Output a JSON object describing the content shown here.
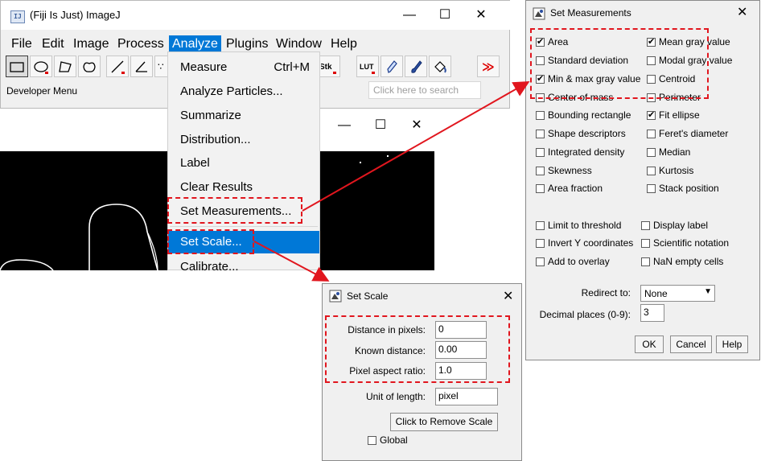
{
  "main_window": {
    "title": "(Fiji Is Just) ImageJ",
    "app_icon_text": "IJ",
    "controls": {
      "minimize": "—",
      "maximize": "☐",
      "close": "✕"
    },
    "menus": [
      "File",
      "Edit",
      "Image",
      "Process",
      "Analyze",
      "Plugins",
      "Window",
      "Help"
    ],
    "toolbar": {
      "text_tools": {
        "stk": "Stk",
        "lut": "LUT"
      },
      "more_tools": "≫",
      "tools": [
        "rectangle-tool",
        "oval-tool",
        "polygon-tool",
        "freehand-tool",
        "line-tool",
        "angle-tool",
        "point-tool",
        "stack-tool",
        "lut-tool",
        "pencil-tool",
        "brush-tool",
        "flood-fill-tool",
        "more-tools"
      ]
    },
    "developer_menu": "Developer Menu",
    "search": {
      "placeholder": "Click here to search"
    }
  },
  "image_window": {
    "controls": {
      "minimize": "—",
      "maximize": "☐",
      "close": "✕"
    }
  },
  "analyze_menu": {
    "items": [
      {
        "label": "Measure",
        "shortcut": "Ctrl+M"
      },
      {
        "label": "Analyze Particles..."
      },
      {
        "label": "Summarize"
      },
      {
        "label": "Distribution..."
      },
      {
        "label": "Label"
      },
      {
        "label": "Clear Results"
      },
      {
        "label": "Set Measurements..."
      },
      {
        "label": "Set Scale..."
      },
      {
        "label": "Calibrate..."
      }
    ]
  },
  "set_measurements": {
    "title": "Set Measurements",
    "left_column": [
      {
        "label": "Area",
        "checked": true
      },
      {
        "label": "Standard deviation",
        "checked": false
      },
      {
        "label": "Min & max gray value",
        "checked": true
      },
      {
        "label": "Center of mass",
        "checked": false
      },
      {
        "label": "Bounding rectangle",
        "checked": false
      },
      {
        "label": "Shape descriptors",
        "checked": false
      },
      {
        "label": "Integrated density",
        "checked": false
      },
      {
        "label": "Skewness",
        "checked": false
      },
      {
        "label": "Area fraction",
        "checked": false
      }
    ],
    "right_column": [
      {
        "label": "Mean gray value",
        "checked": true
      },
      {
        "label": "Modal gray value",
        "checked": false
      },
      {
        "label": "Centroid",
        "checked": false
      },
      {
        "label": "Perimeter",
        "checked": false
      },
      {
        "label": "Fit ellipse",
        "checked": true
      },
      {
        "label": "Feret's diameter",
        "checked": false
      },
      {
        "label": "Median",
        "checked": false
      },
      {
        "label": "Kurtosis",
        "checked": false
      },
      {
        "label": "Stack position",
        "checked": false
      }
    ],
    "options_left": [
      {
        "label": "Limit to threshold",
        "checked": false
      },
      {
        "label": "Invert Y coordinates",
        "checked": false
      },
      {
        "label": "Add to overlay",
        "checked": false
      }
    ],
    "options_right": [
      {
        "label": "Display label",
        "checked": false
      },
      {
        "label": "Scientific notation",
        "checked": false
      },
      {
        "label": "NaN empty cells",
        "checked": false
      }
    ],
    "redirect_label": "Redirect to:",
    "redirect_value": "None",
    "decimal_label": "Decimal places (0-9):",
    "decimal_value": "3",
    "ok": "OK",
    "cancel": "Cancel",
    "help": "Help"
  },
  "set_scale": {
    "title": "Set Scale",
    "distance_label": "Distance in pixels:",
    "distance_value": "0",
    "known_label": "Known distance:",
    "known_value": "0.00",
    "aspect_label": "Pixel aspect ratio:",
    "aspect_value": "1.0",
    "unit_label": "Unit of length:",
    "unit_value": "pixel",
    "remove_button": "Click to Remove Scale",
    "global_label": "Global",
    "global_checked": false,
    "close": "✕"
  },
  "colors": {
    "annotation": "#e1161e",
    "menu_highlight": "#0078d7"
  }
}
